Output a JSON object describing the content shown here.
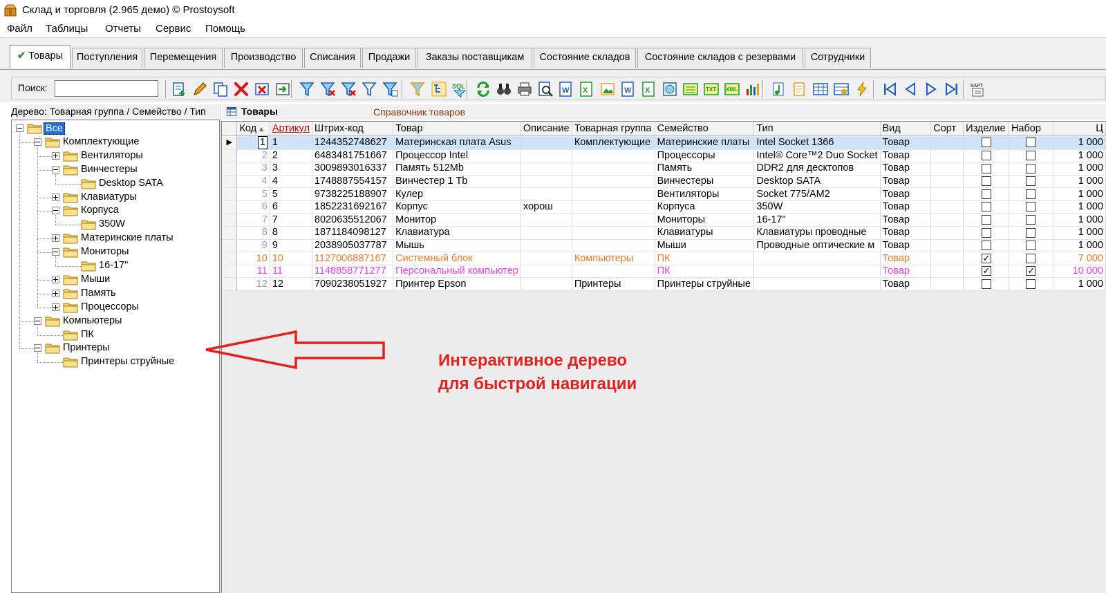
{
  "window": {
    "title": "Склад и торговля (2.965 демо) © Prostoysoft"
  },
  "menu": [
    "Файл",
    "Таблицы",
    "Отчеты",
    "Сервис",
    "Помощь"
  ],
  "tabs": [
    {
      "label": "Товары",
      "active": true
    },
    {
      "label": "Поступления"
    },
    {
      "label": "Перемещения"
    },
    {
      "label": "Производство"
    },
    {
      "label": "Списания"
    },
    {
      "label": "Продажи"
    },
    {
      "label": "Заказы поставщикам"
    },
    {
      "label": "Состояние складов"
    },
    {
      "label": "Состояние складов с резервами"
    },
    {
      "label": "Сотрудники"
    }
  ],
  "toolbar": {
    "search_label": "Поиск:",
    "search_value": "",
    "buttons": [
      "add-record-icon",
      "edit-pencil-icon",
      "copy-record-icon",
      "delete-icon",
      "delete-group-icon",
      "import-icon",
      "filter-icon",
      "filter-remove-icon",
      "filter-clear-icon",
      "filter-outline-icon",
      "filter-edit-icon",
      "filter-funnel-icon",
      "tree-filter-icon",
      "sql-icon",
      "refresh-icon",
      "binoculars-icon",
      "print-icon",
      "preview-icon",
      "export-word-icon",
      "export-excel-icon",
      "export-picture-icon",
      "export-word2-icon",
      "export-excel2-icon",
      "export-html-icon",
      "export-csv-icon",
      "export-txt-icon",
      "export-xml-icon",
      "chart-icon",
      "music-note-icon",
      "document-icon",
      "table-icon",
      "settings-table-icon",
      "lightning-icon",
      "first-record-icon",
      "prev-record-icon",
      "next-record-icon",
      "last-record-icon",
      "card-icon"
    ]
  },
  "tree": {
    "header": "Дерево: Товарная группа / Семейство / Тип",
    "nodes": [
      {
        "label": "Все",
        "level": 0,
        "expander": "minus",
        "selected": true
      },
      {
        "label": "Комплектующие",
        "level": 1,
        "expander": "minus"
      },
      {
        "label": "Вентиляторы",
        "level": 2,
        "expander": "plus"
      },
      {
        "label": "Винчестеры",
        "level": 2,
        "expander": "minus"
      },
      {
        "label": "Desktop SATA",
        "level": 3,
        "expander": "none"
      },
      {
        "label": "Клавиатуры",
        "level": 2,
        "expander": "plus"
      },
      {
        "label": "Корпуса",
        "level": 2,
        "expander": "minus"
      },
      {
        "label": "350W",
        "level": 3,
        "expander": "none"
      },
      {
        "label": "Материнские платы",
        "level": 2,
        "expander": "plus"
      },
      {
        "label": "Мониторы",
        "level": 2,
        "expander": "minus"
      },
      {
        "label": "16-17\"",
        "level": 3,
        "expander": "none"
      },
      {
        "label": "Мыши",
        "level": 2,
        "expander": "plus"
      },
      {
        "label": "Память",
        "level": 2,
        "expander": "plus"
      },
      {
        "label": "Процессоры",
        "level": 2,
        "expander": "plus"
      },
      {
        "label": "Компьютеры",
        "level": 1,
        "expander": "minus"
      },
      {
        "label": "ПК",
        "level": 2,
        "expander": "none"
      },
      {
        "label": "Принтеры",
        "level": 1,
        "expander": "minus"
      },
      {
        "label": "Принтеры струйные",
        "level": 2,
        "expander": "none"
      }
    ]
  },
  "grid": {
    "title": "Товары",
    "subtitle": "Справочник товаров",
    "columns": [
      "Код",
      "Артикул",
      "Штрих-код",
      "Товар",
      "Описание",
      "Товарная группа",
      "Семейство",
      "Тип",
      "Вид",
      "Сорт",
      "Изделие",
      "Набор",
      "Ц"
    ],
    "rows": [
      {
        "kod": "1",
        "art": "1",
        "barcode": "1244352748627",
        "name": "Материнская плата Asus",
        "desc": "",
        "group": "Комплектующие",
        "family": "Материнские платы",
        "type": "Intel Socket 1366",
        "kind": "Товар",
        "sort": "",
        "izd": false,
        "nabor": false,
        "price": "1 000",
        "style": "selected"
      },
      {
        "kod": "2",
        "art": "2",
        "barcode": "6483481751667",
        "name": "Процессор Intel",
        "desc": "",
        "group": "",
        "family": "Процессоры",
        "type": "Intel® Core™2 Duo Socket",
        "kind": "Товар",
        "sort": "",
        "izd": false,
        "nabor": false,
        "price": "1 000",
        "style": ""
      },
      {
        "kod": "3",
        "art": "3",
        "barcode": "3009893016337",
        "name": "Память 512Mb",
        "desc": "",
        "group": "",
        "family": "Память",
        "type": "DDR2 для десктопов",
        "kind": "Товар",
        "sort": "",
        "izd": false,
        "nabor": false,
        "price": "1 000",
        "style": ""
      },
      {
        "kod": "4",
        "art": "4",
        "barcode": "1748887554157",
        "name": "Винчестер 1 Tb",
        "desc": "",
        "group": "",
        "family": "Винчестеры",
        "type": "Desktop SATA",
        "kind": "Товар",
        "sort": "",
        "izd": false,
        "nabor": false,
        "price": "1 000",
        "style": ""
      },
      {
        "kod": "5",
        "art": "5",
        "barcode": "9738225188907",
        "name": "Кулер",
        "desc": "",
        "group": "",
        "family": "Вентиляторы",
        "type": "Socket 775/AM2",
        "kind": "Товар",
        "sort": "",
        "izd": false,
        "nabor": false,
        "price": "1 000",
        "style": ""
      },
      {
        "kod": "6",
        "art": "6",
        "barcode": "1852231692167",
        "name": "Корпус",
        "desc": "хорош",
        "group": "",
        "family": "Корпуса",
        "type": "350W",
        "kind": "Товар",
        "sort": "",
        "izd": false,
        "nabor": false,
        "price": "1 000",
        "style": ""
      },
      {
        "kod": "7",
        "art": "7",
        "barcode": "8020635512067",
        "name": "Монитор",
        "desc": "",
        "group": "",
        "family": "Мониторы",
        "type": "16-17\"",
        "kind": "Товар",
        "sort": "",
        "izd": false,
        "nabor": false,
        "price": "1 000",
        "style": ""
      },
      {
        "kod": "8",
        "art": "8",
        "barcode": "1871184098127",
        "name": "Клавиатура",
        "desc": "",
        "group": "",
        "family": "Клавиатуры",
        "type": "Клавиатуры проводные",
        "kind": "Товар",
        "sort": "",
        "izd": false,
        "nabor": false,
        "price": "1 000",
        "style": ""
      },
      {
        "kod": "9",
        "art": "9",
        "barcode": "2038905037787",
        "name": "Мышь",
        "desc": "",
        "group": "",
        "family": "Мыши",
        "type": "Проводные оптические м",
        "kind": "Товар",
        "sort": "",
        "izd": false,
        "nabor": false,
        "price": "1 000",
        "style": ""
      },
      {
        "kod": "10",
        "art": "10",
        "barcode": "1127006887167",
        "name": "Системный блок",
        "desc": "",
        "group": "Компьютеры",
        "family": "ПК",
        "type": "",
        "kind": "Товар",
        "sort": "",
        "izd": true,
        "nabor": false,
        "price": "7 000",
        "style": "orange"
      },
      {
        "kod": "11",
        "art": "11",
        "barcode": "1148858771277",
        "name": "Персональный компьютер",
        "desc": "",
        "group": "",
        "family": "ПК",
        "type": "",
        "kind": "Товар",
        "sort": "",
        "izd": true,
        "nabor": true,
        "price": "10 000",
        "style": "pink"
      },
      {
        "kod": "12",
        "art": "12",
        "barcode": "7090238051927",
        "name": "Принтер Epson",
        "desc": "",
        "group": "Принтеры",
        "family": "Принтеры струйные",
        "type": "",
        "kind": "Товар",
        "sort": "",
        "izd": false,
        "nabor": false,
        "price": "1 000",
        "style": ""
      }
    ]
  },
  "annotation": {
    "line1": "Интерактивное дерево",
    "line2": "для быстрой навигации",
    "color": "#e32020"
  },
  "colors": {
    "selection": "#1e6fd9",
    "row_selected": "#cfe3fa",
    "row_orange": "#f07a2a",
    "row_pink": "#ea3fea",
    "subtitle": "#8b3a12"
  }
}
